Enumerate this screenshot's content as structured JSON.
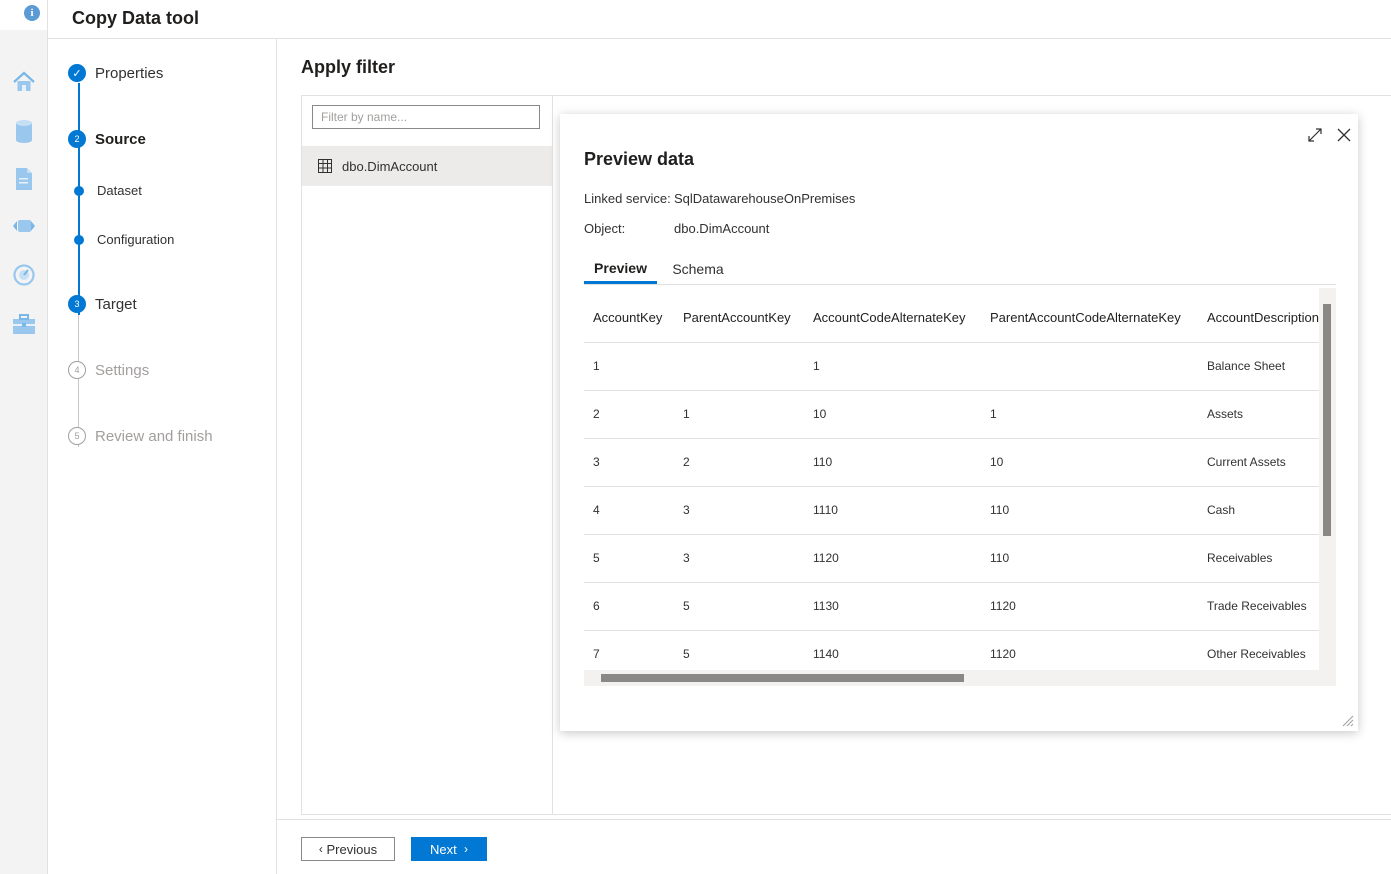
{
  "app": {
    "title": "Copy Data tool",
    "info_icon": "i"
  },
  "left_rail": {
    "icons": [
      "home-icon",
      "database-icon",
      "document-icon",
      "pipeline-icon",
      "monitor-icon",
      "toolbox-icon"
    ]
  },
  "steps": {
    "properties": {
      "label": "Properties",
      "marker": "✓"
    },
    "source": {
      "label": "Source",
      "number": "2"
    },
    "dataset": {
      "label": "Dataset"
    },
    "configuration": {
      "label": "Configuration"
    },
    "target": {
      "label": "Target",
      "number": "3"
    },
    "settings": {
      "label": "Settings",
      "number": "4"
    },
    "review": {
      "label": "Review and finish",
      "number": "5"
    }
  },
  "page": {
    "title": "Apply filter",
    "filter_placeholder": "Filter by name...",
    "selected_item": "dbo.DimAccount"
  },
  "preview": {
    "title": "Preview data",
    "linked_service_label": "Linked service:",
    "linked_service_value": "SqlDatawarehouseOnPremises",
    "object_label": "Object:",
    "object_value": "dbo.DimAccount",
    "tabs": [
      "Preview",
      "Schema"
    ],
    "columns": [
      "AccountKey",
      "ParentAccountKey",
      "AccountCodeAlternateKey",
      "ParentAccountCodeAlternateKey",
      "AccountDescription"
    ],
    "rows": [
      [
        "1",
        "",
        "1",
        "",
        "Balance Sheet"
      ],
      [
        "2",
        "1",
        "10",
        "1",
        "Assets"
      ],
      [
        "3",
        "2",
        "110",
        "10",
        "Current Assets"
      ],
      [
        "4",
        "3",
        "1110",
        "110",
        "Cash"
      ],
      [
        "5",
        "3",
        "1120",
        "110",
        "Receivables"
      ],
      [
        "6",
        "5",
        "1130",
        "1120",
        "Trade Receivables"
      ],
      [
        "7",
        "5",
        "1140",
        "1120",
        "Other Receivables"
      ]
    ]
  },
  "footer": {
    "previous_label": "Previous",
    "next_label": "Next",
    "previous_chevron": "‹",
    "next_chevron": "›"
  },
  "colors": {
    "accent": "#0078d4",
    "muted": "#a19f9d",
    "selected_bg": "#edebe9"
  }
}
